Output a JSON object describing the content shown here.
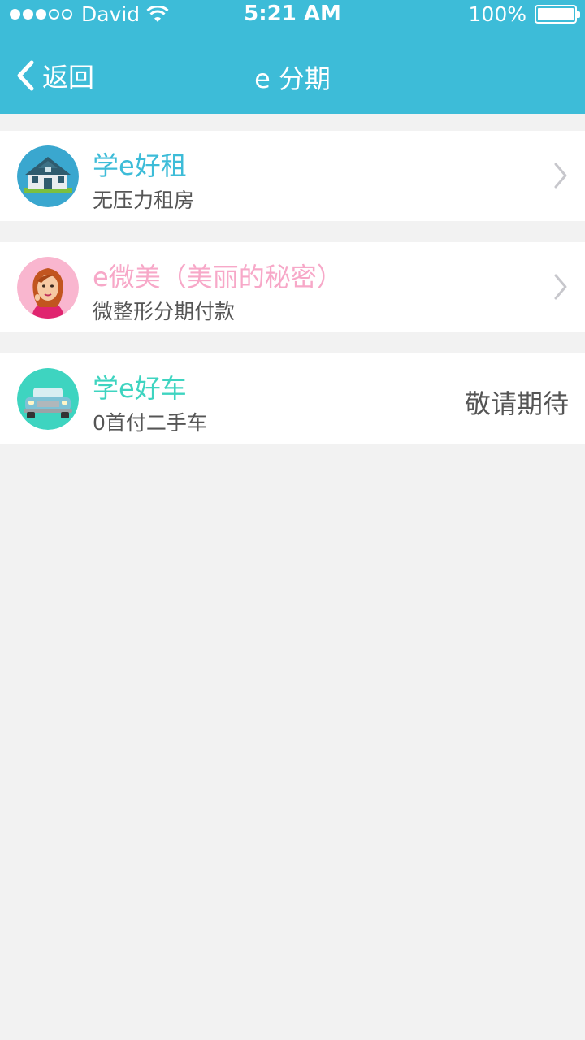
{
  "statusbar": {
    "carrier": "David",
    "time": "5:21 AM",
    "battery": "100%",
    "signal_full": 3,
    "signal_total": 5
  },
  "nav": {
    "back_label": "返回",
    "title": "e 分期"
  },
  "items": [
    {
      "title": "学e好租",
      "subtitle": "无压力租房",
      "icon": "house-icon",
      "title_color": "#3dbcd8",
      "action": "chevron-right-icon"
    },
    {
      "title": "e微美（美丽的秘密）",
      "subtitle": "微整形分期付款",
      "icon": "woman-icon",
      "title_color": "#f7a8c8",
      "action": "chevron-right-icon"
    },
    {
      "title": "学e好车",
      "subtitle": "0首付二手车",
      "icon": "car-icon",
      "title_color": "#3ed4c0",
      "status": "敬请期待"
    }
  ],
  "colors": {
    "header_bg": "#3dbcd8",
    "page_bg": "#f2f2f2",
    "row_bg": "#ffffff",
    "subtitle": "#555555"
  }
}
